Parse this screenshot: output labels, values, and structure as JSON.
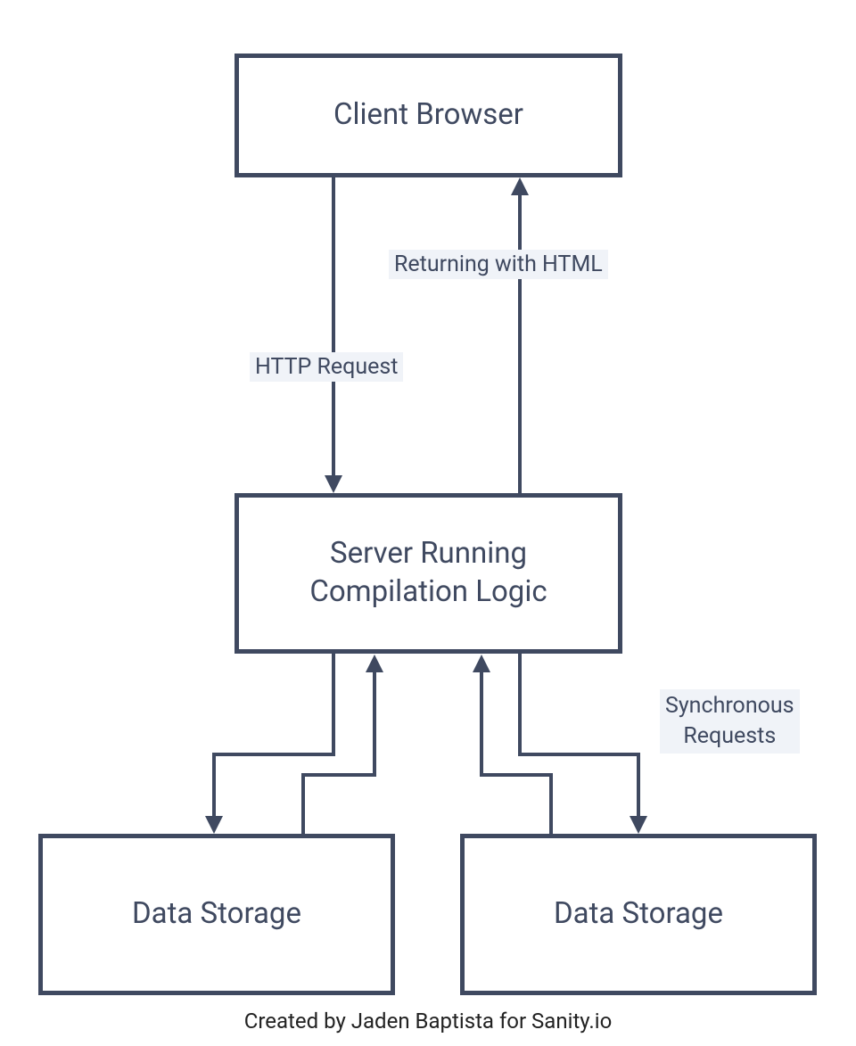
{
  "colors": {
    "line": "#3f4960",
    "text": "#3f4960",
    "labelBg": "#f0f3f8",
    "background": "#ffffff"
  },
  "boxes": {
    "client": {
      "label": "Client Browser"
    },
    "server": {
      "label": "Server Running\nCompilation Logic"
    },
    "storage1": {
      "label": "Data Storage"
    },
    "storage2": {
      "label": "Data Storage"
    }
  },
  "edges": {
    "httpRequest": {
      "label": "HTTP Request",
      "from": "client",
      "to": "server",
      "direction": "down"
    },
    "returningHtml": {
      "label": "Returning with HTML",
      "from": "server",
      "to": "client",
      "direction": "up"
    },
    "syncRequests": {
      "label": "Synchronous\nRequests",
      "between": [
        "server",
        "storage1",
        "storage2"
      ],
      "bidirectional": true
    }
  },
  "attribution": "Created by Jaden Baptista for Sanity.io"
}
